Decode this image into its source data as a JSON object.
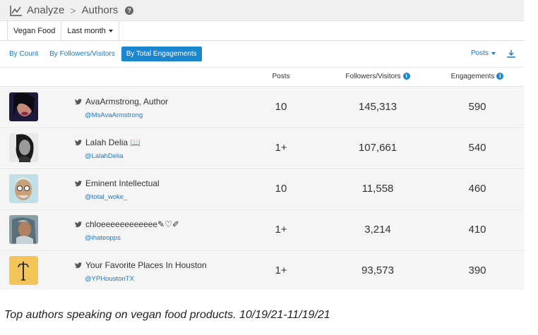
{
  "header": {
    "app_title": "Analyze",
    "breadcrumb_current": "Authors",
    "help_label": "?"
  },
  "filters": {
    "topic": "Vegan Food",
    "date_range": "Last month"
  },
  "tabs": [
    {
      "label": "By Count",
      "active": false
    },
    {
      "label": "By Followers/Visitors",
      "active": false
    },
    {
      "label": "By Total Engagements",
      "active": true
    }
  ],
  "sort_select": "Posts",
  "table": {
    "columns": {
      "posts": "Posts",
      "followers": "Followers/Visitors",
      "engagements": "Engagements"
    },
    "rows": [
      {
        "name": "AvaArmstrong, Author",
        "handle": "@MsAvaArmstrong",
        "posts": "10",
        "followers": "145,313",
        "engagements": "590"
      },
      {
        "name": "Lalah Delia 📖",
        "handle": "@LalahDelia",
        "posts": "1+",
        "followers": "107,661",
        "engagements": "540"
      },
      {
        "name": "Eminent Intellectual",
        "handle": "@total_woke_",
        "posts": "10",
        "followers": "11,558",
        "engagements": "460"
      },
      {
        "name": "chloeeeeeeeeeeee✎♡✐",
        "handle": "@ihateopps",
        "posts": "1+",
        "followers": "3,214",
        "engagements": "410"
      },
      {
        "name": "Your Favorite Places In Houston",
        "handle": "@YPHoustonTX",
        "posts": "1+",
        "followers": "93,573",
        "engagements": "390"
      }
    ]
  },
  "caption": "Top authors speaking on vegan food products. 10/19/21-11/19/21",
  "colors": {
    "accent": "#1a86d0",
    "link": "#1a7bc4",
    "row_bg": "#f5f5f5"
  }
}
